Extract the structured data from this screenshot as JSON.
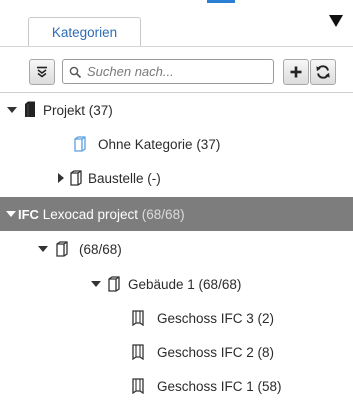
{
  "tabs": [
    {
      "label": "Kategorien",
      "active": true
    }
  ],
  "toolbar": {
    "search_placeholder": "Suchen nach...",
    "collapse_icon": "collapse-all-icon",
    "add_icon": "plus-icon",
    "refresh_icon": "refresh-icon"
  },
  "tree": {
    "project": {
      "label": "Projekt (37)",
      "expanded": true,
      "icon": "building-icon"
    },
    "ohne_kategorie": {
      "label": "Ohne Kategorie (37)",
      "icon": "category-icon"
    },
    "baustelle": {
      "label": "Baustelle (-)",
      "expanded": false,
      "icon": "category-icon"
    },
    "ifc_root": {
      "tag": "IFC",
      "name": "Lexocad project",
      "count": "(68/68)",
      "selected": true,
      "expanded": true
    },
    "site": {
      "label": "(68/68)",
      "expanded": true,
      "icon": "category-icon"
    },
    "gebaeude": {
      "label": "Gebäude 1 (68/68)",
      "expanded": true,
      "icon": "category-icon"
    },
    "storeys": [
      {
        "label": "Geschoss IFC 3 (2)",
        "icon": "storey-icon"
      },
      {
        "label": "Geschoss IFC 2 (8)",
        "icon": "storey-icon"
      },
      {
        "label": "Geschoss IFC 1 (58)",
        "icon": "storey-icon"
      }
    ]
  },
  "colors": {
    "accent": "#2a7fd4",
    "tab_text": "#2f6db5",
    "selected_row": "#7d7d7d",
    "category_icon_light": "#5aa0e0"
  }
}
